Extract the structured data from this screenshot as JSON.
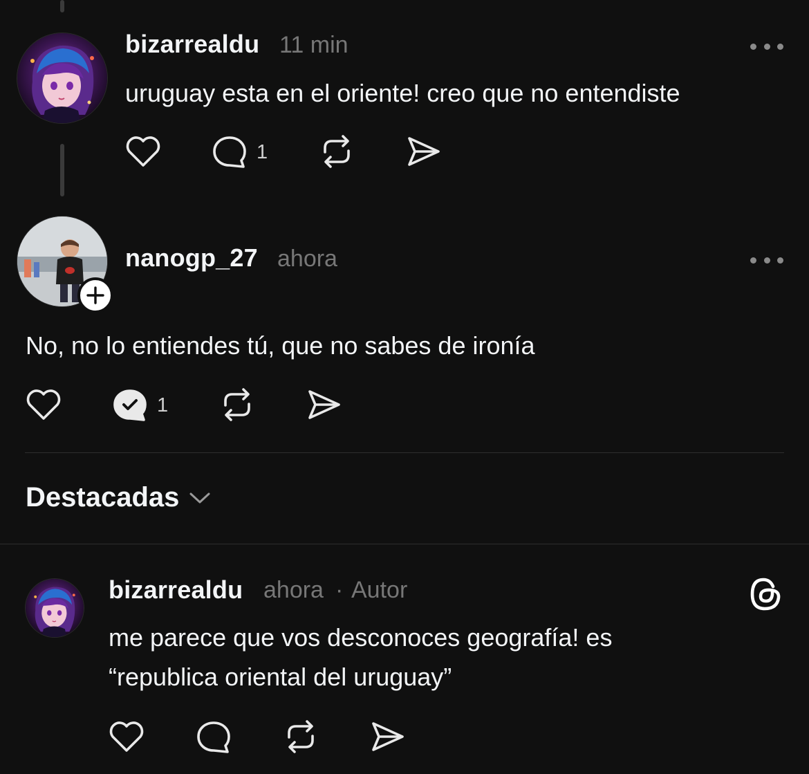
{
  "posts": [
    {
      "username": "bizarrealdu",
      "time": "11 min",
      "text": "uruguay esta en el oriente! creo que no entendiste",
      "reply_count": "1",
      "avatar_icon": "anime-avatar"
    },
    {
      "username": "nanogp_27",
      "time": "ahora",
      "text": "No, no lo entiendes tú, que no sabes de ironía",
      "reply_count": "1",
      "avatar_icon": "photo-avatar",
      "follow_icon": "plus-icon"
    }
  ],
  "section": {
    "title": "Destacadas"
  },
  "featured": {
    "username": "bizarrealdu",
    "time": "ahora",
    "separator": "·",
    "role": "Autor",
    "text_line1": "me parece que vos desconoces geografía! es",
    "text_line2": "“republica oriental del uruguay”",
    "badge_icon": "threads-logo-icon"
  },
  "icons": {
    "like": "heart-icon",
    "reply": "reply-bubble-icon",
    "reply_active": "reply-bubble-check-icon",
    "repost": "repost-icon",
    "share": "send-icon",
    "more": "more-dots-icon",
    "chevron": "chevron-down-icon"
  },
  "colors": {
    "background": "#101010",
    "text": "#f3f5f7",
    "muted": "#777777",
    "divider": "#2e2e2e"
  }
}
